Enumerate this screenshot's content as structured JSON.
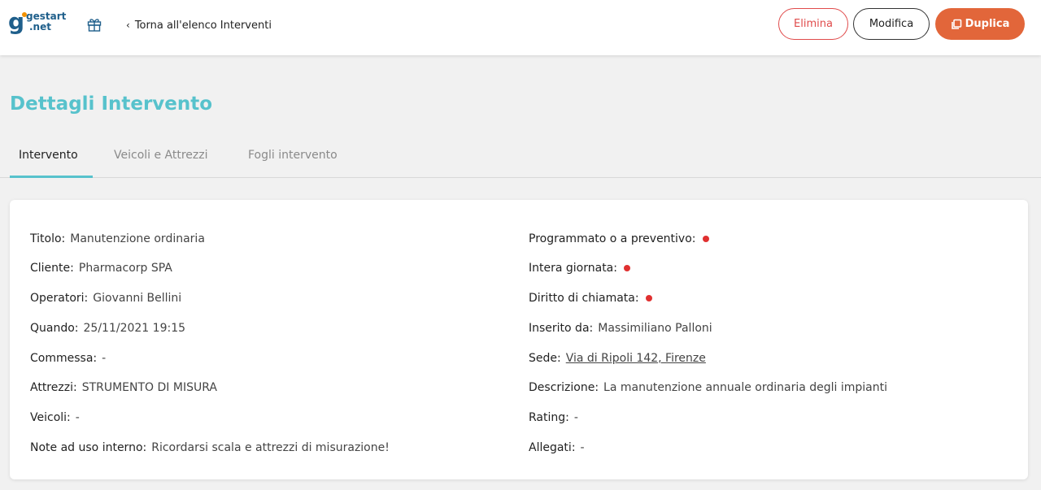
{
  "header": {
    "brand_line1": "gestart",
    "brand_line2": ".net",
    "back_label": "Torna all'elenco Interventi",
    "delete_label": "Elimina",
    "edit_label": "Modifica",
    "duplicate_label": "Duplica"
  },
  "page": {
    "title": "Dettagli Intervento"
  },
  "tabs": [
    {
      "label": "Intervento"
    },
    {
      "label": "Veicoli e Attrezzi"
    },
    {
      "label": "Fogli intervento"
    }
  ],
  "details_left": [
    {
      "label": "Titolo:",
      "value": "Manutenzione ordinaria"
    },
    {
      "label": "Cliente:",
      "value": "Pharmacorp SPA"
    },
    {
      "label": "Operatori:",
      "value": "Giovanni Bellini"
    },
    {
      "label": "Quando:",
      "value": "25/11/2021 19:15"
    },
    {
      "label": "Commessa:",
      "value": "-"
    },
    {
      "label": "Attrezzi:",
      "value": "STRUMENTO DI MISURA"
    },
    {
      "label": "Veicoli:",
      "value": "-"
    },
    {
      "label": "Note ad uso interno:",
      "value": "Ricordarsi scala e attrezzi di misurazione!"
    }
  ],
  "details_right": [
    {
      "label": "Programmato o a preventivo:"
    },
    {
      "label": "Intera giornata:"
    },
    {
      "label": "Diritto di chiamata:"
    },
    {
      "label": "Inserito da:",
      "value": "Massimiliano Palloni"
    },
    {
      "label": "Sede:",
      "value": "Via di Ripoli 142, Firenze"
    },
    {
      "label": "Descrizione:",
      "value": "La manutenzione annuale ordinaria degli impianti"
    },
    {
      "label": "Rating:",
      "value": "-"
    },
    {
      "label": "Allegati:",
      "value": "-"
    }
  ],
  "colors": {
    "accent": "#57c2cc",
    "danger": "#e04b4b",
    "primary_button": "#e2663a",
    "status_dot": "#e03030"
  }
}
